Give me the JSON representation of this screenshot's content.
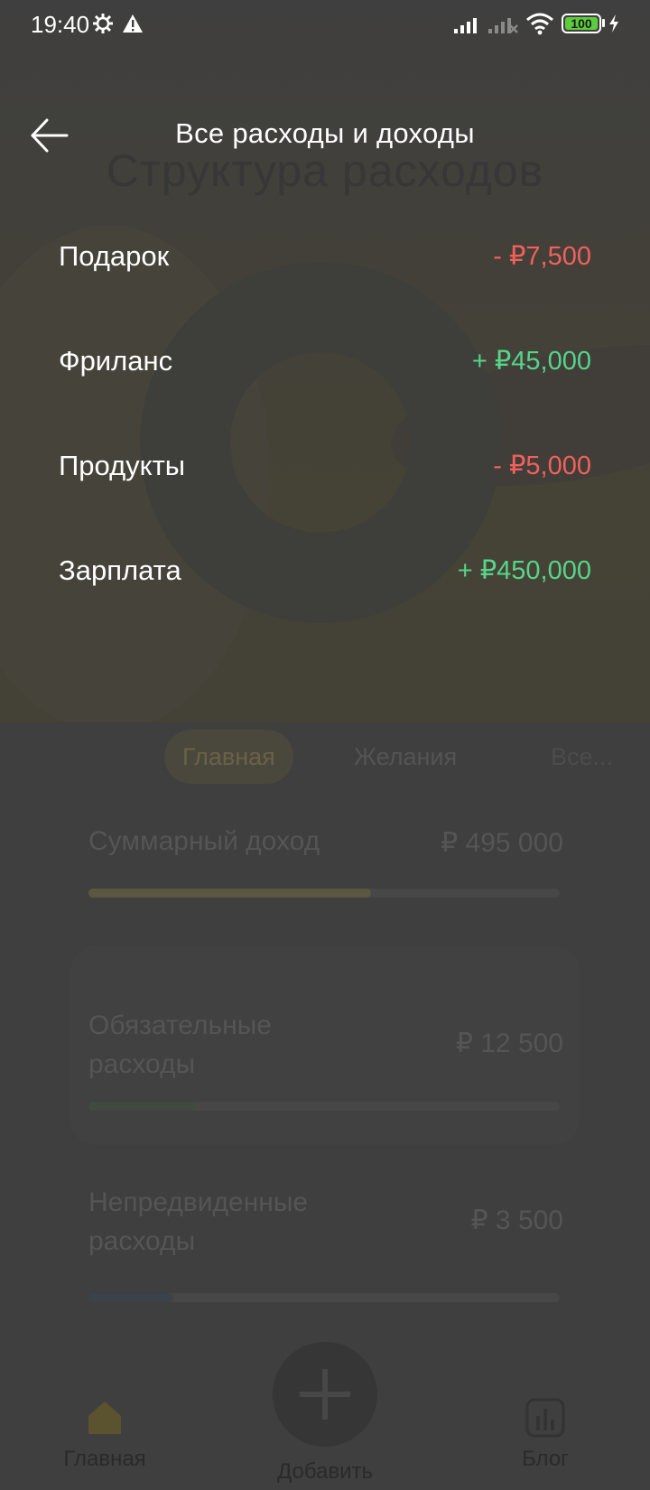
{
  "status_bar": {
    "time": "19:40",
    "battery": "100"
  },
  "background_screen": {
    "title": "Структура расходов",
    "tabs": [
      "Главная",
      "Желания",
      "Все..."
    ],
    "cards": [
      {
        "label": "Суммарный доход",
        "amount": "₽ 495 000",
        "progress": 0.6,
        "color": "#5a5741"
      },
      {
        "label": "Обязательные расходы",
        "amount": "₽ 12 500",
        "progress": 0.23,
        "color": "#3f4a40"
      },
      {
        "label": "Непредвиденные расходы",
        "amount": "₽ 3 500",
        "progress": 0.18,
        "color": "#3c4249"
      }
    ],
    "nav": {
      "home_label": "Главная",
      "add_label": "Добавить",
      "blog_label": "Блог"
    }
  },
  "modal": {
    "title": "Все расходы и доходы",
    "transactions": [
      {
        "name": "Подарок",
        "amount": "- ₽7,500",
        "type": "expense"
      },
      {
        "name": "Фриланс",
        "amount": "+ ₽45,000",
        "type": "income"
      },
      {
        "name": "Продукты",
        "amount": "- ₽5,000",
        "type": "expense"
      },
      {
        "name": "Зарплата",
        "amount": "+ ₽450,000",
        "type": "income"
      }
    ]
  },
  "colors": {
    "expense": "#f0615c",
    "income": "#57d48a",
    "overlay": "#3f3f3f"
  }
}
